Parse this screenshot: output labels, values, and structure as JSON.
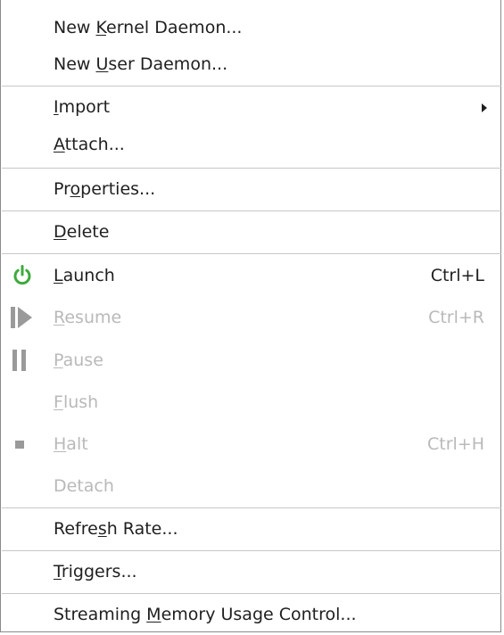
{
  "menu": {
    "items": [
      {
        "pre": "New ",
        "mn": "K",
        "post": "ernel Daemon...",
        "accel": "",
        "enabled": true
      },
      {
        "pre": "New ",
        "mn": "U",
        "post": "ser Daemon...",
        "accel": "",
        "enabled": true
      },
      {
        "pre": "",
        "mn": "I",
        "post": "mport",
        "accel": "",
        "enabled": true,
        "submenu": true
      },
      {
        "pre": "",
        "mn": "A",
        "post": "ttach...",
        "accel": "",
        "enabled": true
      },
      {
        "pre": "Pr",
        "mn": "o",
        "post": "perties...",
        "accel": "",
        "enabled": true
      },
      {
        "pre": "",
        "mn": "D",
        "post": "elete",
        "accel": "",
        "enabled": true
      },
      {
        "pre": "",
        "mn": "L",
        "post": "aunch",
        "accel": "Ctrl+L",
        "enabled": true,
        "icon": "power-icon"
      },
      {
        "pre": "",
        "mn": "R",
        "post": "esume",
        "accel": "Ctrl+R",
        "enabled": false,
        "icon": "resume-icon"
      },
      {
        "pre": "",
        "mn": "P",
        "post": "ause",
        "accel": "",
        "enabled": false,
        "icon": "pause-icon"
      },
      {
        "pre": "",
        "mn": "F",
        "post": "lush",
        "accel": "",
        "enabled": false
      },
      {
        "pre": "",
        "mn": "H",
        "post": "alt",
        "accel": "Ctrl+H",
        "enabled": false,
        "icon": "stop-icon"
      },
      {
        "pre": "Detach",
        "mn": "",
        "post": "",
        "accel": "",
        "enabled": false
      },
      {
        "pre": "Refre",
        "mn": "s",
        "post": "h Rate...",
        "accel": "",
        "enabled": true
      },
      {
        "pre": "",
        "mn": "T",
        "post": "riggers...",
        "accel": "",
        "enabled": true
      },
      {
        "pre": "Streaming ",
        "mn": "M",
        "post": "emory Usage Control...",
        "accel": "",
        "enabled": true
      }
    ]
  },
  "colors": {
    "text": "#1f1f1f",
    "disabled_text": "#b9b9b9",
    "power_icon": "#3daa3d",
    "disabled_icon": "#9a9a9a",
    "separator": "#c7c7c7"
  }
}
